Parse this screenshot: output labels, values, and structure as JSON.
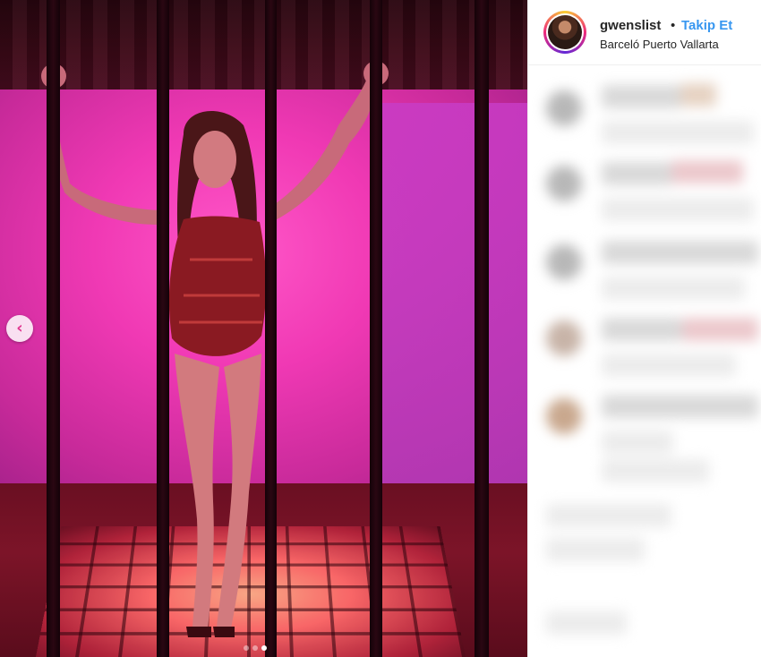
{
  "post": {
    "photo_nav": {
      "prev_icon": "chevron-left-icon",
      "prev_glyph": "‹"
    },
    "carousel": {
      "total": 3,
      "active_index": 2
    }
  },
  "header": {
    "username": "gwenslist",
    "separator": "•",
    "follow_label": "Takip Et",
    "location": "Barceló Puerto Vallarta"
  },
  "colors": {
    "follow_blue": "#3897f0",
    "text_dark": "#262626",
    "wall_magenta": "#f039b4",
    "nav_accent": "#e0368f"
  }
}
